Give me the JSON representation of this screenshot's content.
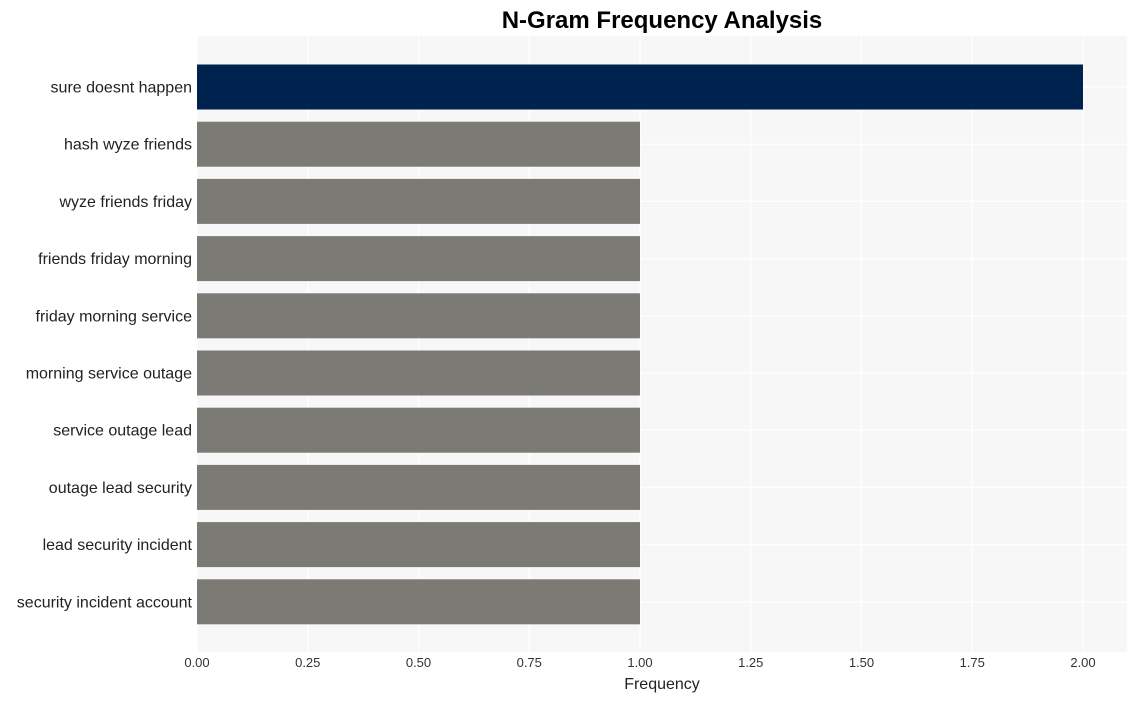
{
  "chart_data": {
    "type": "bar",
    "orientation": "horizontal",
    "title": "N-Gram Frequency Analysis",
    "xlabel": "Frequency",
    "ylabel": "",
    "categories": [
      "sure doesnt happen",
      "hash wyze friends",
      "wyze friends friday",
      "friends friday morning",
      "friday morning service",
      "morning service outage",
      "service outage lead",
      "outage lead security",
      "lead security incident",
      "security incident account"
    ],
    "values": [
      2,
      1,
      1,
      1,
      1,
      1,
      1,
      1,
      1,
      1
    ],
    "xlim": [
      0,
      2.1
    ],
    "xticks": [
      0,
      0.25,
      0.5,
      0.75,
      1.0,
      1.25,
      1.5,
      1.75,
      2.0
    ],
    "xtick_labels": [
      "0.00",
      "0.25",
      "0.50",
      "0.75",
      "1.00",
      "1.25",
      "1.50",
      "1.75",
      "2.00"
    ],
    "grid": true,
    "legend": "none",
    "colors": {
      "highlight": "#00224e",
      "default": "#7b7a75",
      "plot_background": "#f7f7f7",
      "gridline": "#ffffff"
    }
  }
}
